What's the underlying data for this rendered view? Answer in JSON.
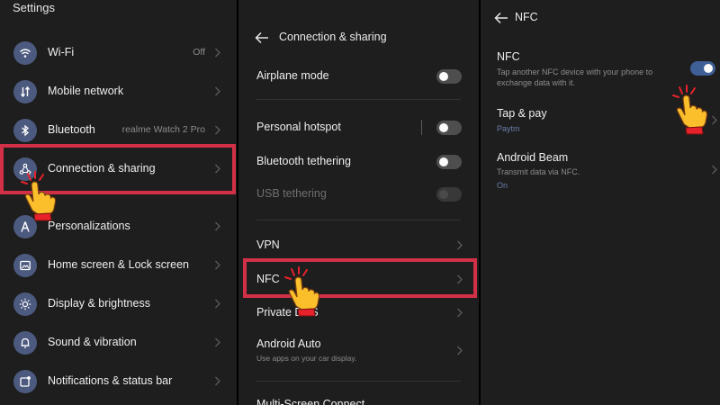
{
  "settings": {
    "title": "Settings",
    "items": [
      {
        "label": "Wi-Fi",
        "value": "Off",
        "icon": "wifi-icon"
      },
      {
        "label": "Mobile network",
        "value": "",
        "icon": "mobile-network-icon"
      },
      {
        "label": "Bluetooth",
        "value": "realme Watch 2 Pro",
        "icon": "bluetooth-icon"
      },
      {
        "label": "Connection & sharing",
        "value": "",
        "icon": "connection-sharing-icon"
      },
      {
        "label": "Personalizations",
        "value": "",
        "icon": "personalizations-icon"
      },
      {
        "label": "Home screen & Lock screen",
        "value": "",
        "icon": "home-screen-icon"
      },
      {
        "label": "Display & brightness",
        "value": "",
        "icon": "brightness-icon"
      },
      {
        "label": "Sound & vibration",
        "value": "",
        "icon": "sound-icon"
      },
      {
        "label": "Notifications & status bar",
        "value": "",
        "icon": "notifications-icon"
      }
    ]
  },
  "connection": {
    "title": "Connection & sharing",
    "airplane_mode": "Airplane mode",
    "personal_hotspot": "Personal hotspot",
    "bluetooth_tethering": "Bluetooth tethering",
    "usb_tethering": "USB tethering",
    "vpn": "VPN",
    "nfc": "NFC",
    "private_dns": "Private DNS",
    "android_auto": "Android Auto",
    "android_auto_sub": "Use apps on your car display.",
    "multi_screen": "Multi-Screen Connect"
  },
  "nfc_page": {
    "title": "NFC",
    "nfc_label": "NFC",
    "nfc_desc": "Tap another NFC device with your phone to exchange data with it.",
    "nfc_enabled": true,
    "tap_pay_label": "Tap & pay",
    "tap_pay_value": "Paytm",
    "android_beam_label": "Android Beam",
    "android_beam_desc": "Transmit data via NFC.",
    "android_beam_value": "On"
  },
  "colors": {
    "panel_background": "#1e1e1e",
    "icon_background": "#4c5a7f",
    "highlight": "#d23046",
    "toggle_on": "#3f5f97",
    "link": "#6a7ea8"
  }
}
